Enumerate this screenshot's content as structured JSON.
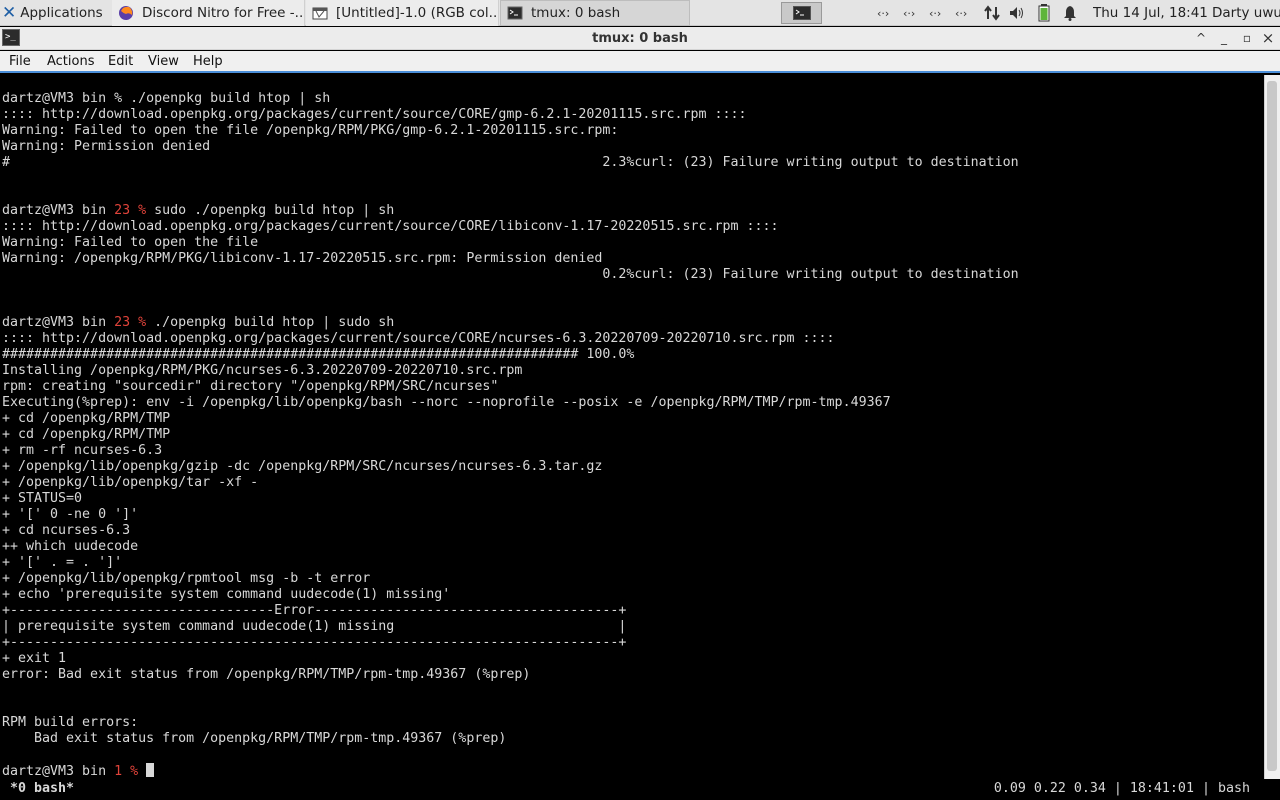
{
  "panel": {
    "applications_label": "Applications",
    "tasks": [
      {
        "label": "Discord Nitro for Free -..."
      },
      {
        "label": "[Untitled]-1.0 (RGB col..."
      },
      {
        "label": "tmux: 0 bash"
      }
    ],
    "clock": "Thu 14 Jul, 18:41",
    "user": "Darty uwu"
  },
  "window": {
    "title": "tmux: 0 bash",
    "controls": {
      "up": "^",
      "minimize": "_",
      "restore": "▫",
      "close": "×"
    }
  },
  "menubar": [
    "File",
    "Actions",
    "Edit",
    "View",
    "Help"
  ],
  "terminal": {
    "lines": [
      {
        "row": 1,
        "segments": [
          {
            "t": "dartz@VM3 bin % ./openpkg build htop | sh"
          }
        ]
      },
      {
        "row": 2,
        "segments": [
          {
            "t": ":::: http://download.openpkg.org/packages/current/source/CORE/gmp-6.2.1-20201115.src.rpm ::::"
          }
        ]
      },
      {
        "row": 3,
        "segments": [
          {
            "t": "Warning: Failed to open the file /openpkg/RPM/PKG/gmp-6.2.1-20201115.src.rpm:"
          }
        ]
      },
      {
        "row": 4,
        "segments": [
          {
            "t": "Warning: Permission denied"
          }
        ]
      },
      {
        "row": 5,
        "segments": [
          {
            "t": "#                                                                          2.3%curl: (23) Failure writing output to destination"
          }
        ]
      },
      {
        "row": 8,
        "segments": [
          {
            "t": "dartz@VM3 bin "
          },
          {
            "t": "23 %",
            "red": true
          },
          {
            "t": " sudo ./openpkg build htop | sh"
          }
        ]
      },
      {
        "row": 9,
        "segments": [
          {
            "t": ":::: http://download.openpkg.org/packages/current/source/CORE/libiconv-1.17-20220515.src.rpm ::::"
          }
        ]
      },
      {
        "row": 10,
        "segments": [
          {
            "t": "Warning: Failed to open the file"
          }
        ]
      },
      {
        "row": 11,
        "segments": [
          {
            "t": "Warning: /openpkg/RPM/PKG/libiconv-1.17-20220515.src.rpm: Permission denied"
          }
        ]
      },
      {
        "row": 12,
        "segments": [
          {
            "t": "                                                                           0.2%curl: (23) Failure writing output to destination"
          }
        ]
      },
      {
        "row": 15,
        "segments": [
          {
            "t": "dartz@VM3 bin "
          },
          {
            "t": "23 %",
            "red": true
          },
          {
            "t": " ./openpkg build htop | sudo sh"
          }
        ]
      },
      {
        "row": 16,
        "segments": [
          {
            "t": ":::: http://download.openpkg.org/packages/current/source/CORE/ncurses-6.3.20220709-20220710.src.rpm ::::"
          }
        ]
      },
      {
        "row": 17,
        "segments": [
          {
            "t": "######################################################################## 100.0%"
          }
        ]
      },
      {
        "row": 18,
        "segments": [
          {
            "t": "Installing /openpkg/RPM/PKG/ncurses-6.3.20220709-20220710.src.rpm"
          }
        ]
      },
      {
        "row": 19,
        "segments": [
          {
            "t": "rpm: creating \"sourcedir\" directory \"/openpkg/RPM/SRC/ncurses\""
          }
        ]
      },
      {
        "row": 20,
        "segments": [
          {
            "t": "Executing(%prep): env -i /openpkg/lib/openpkg/bash --norc --noprofile --posix -e /openpkg/RPM/TMP/rpm-tmp.49367"
          }
        ]
      },
      {
        "row": 21,
        "segments": [
          {
            "t": "+ cd /openpkg/RPM/TMP"
          }
        ]
      },
      {
        "row": 22,
        "segments": [
          {
            "t": "+ cd /openpkg/RPM/TMP"
          }
        ]
      },
      {
        "row": 23,
        "segments": [
          {
            "t": "+ rm -rf ncurses-6.3"
          }
        ]
      },
      {
        "row": 24,
        "segments": [
          {
            "t": "+ /openpkg/lib/openpkg/gzip -dc /openpkg/RPM/SRC/ncurses/ncurses-6.3.tar.gz"
          }
        ]
      },
      {
        "row": 25,
        "segments": [
          {
            "t": "+ /openpkg/lib/openpkg/tar -xf -"
          }
        ]
      },
      {
        "row": 26,
        "segments": [
          {
            "t": "+ STATUS=0"
          }
        ]
      },
      {
        "row": 27,
        "segments": [
          {
            "t": "+ '[' 0 -ne 0 ']'"
          }
        ]
      },
      {
        "row": 28,
        "segments": [
          {
            "t": "+ cd ncurses-6.3"
          }
        ]
      },
      {
        "row": 29,
        "segments": [
          {
            "t": "++ which uudecode"
          }
        ]
      },
      {
        "row": 30,
        "segments": [
          {
            "t": "+ '[' . = . ']'"
          }
        ]
      },
      {
        "row": 31,
        "segments": [
          {
            "t": "+ /openpkg/lib/openpkg/rpmtool msg -b -t error"
          }
        ]
      },
      {
        "row": 32,
        "segments": [
          {
            "t": "+ echo 'prerequisite system command uudecode(1) missing'"
          }
        ]
      },
      {
        "row": 33,
        "segments": [
          {
            "t": "+---------------------------------Error--------------------------------------+"
          }
        ]
      },
      {
        "row": 34,
        "segments": [
          {
            "t": "| prerequisite system command uudecode(1) missing                            |"
          }
        ]
      },
      {
        "row": 35,
        "segments": [
          {
            "t": "+----------------------------------------------------------------------------+"
          }
        ]
      },
      {
        "row": 36,
        "segments": [
          {
            "t": "+ exit 1"
          }
        ]
      },
      {
        "row": 37,
        "segments": [
          {
            "t": "error: Bad exit status from /openpkg/RPM/TMP/rpm-tmp.49367 (%prep)"
          }
        ]
      },
      {
        "row": 40,
        "segments": [
          {
            "t": "RPM build errors:"
          }
        ]
      },
      {
        "row": 41,
        "segments": [
          {
            "t": "    Bad exit status from /openpkg/RPM/TMP/rpm-tmp.49367 (%prep)"
          }
        ]
      },
      {
        "row": 43,
        "segments": [
          {
            "t": "dartz@VM3 bin "
          },
          {
            "t": "1 %",
            "red": true
          },
          {
            "t": " "
          }
        ],
        "cursor": true
      }
    ]
  },
  "tmux": {
    "left": "*0 bash*",
    "right": "0.09 0.22 0.34 | 18:41:01 | bash"
  },
  "colors": {
    "panel_bg": "#e4e4e4",
    "terminal_bg": "#000000",
    "terminal_fg": "#d8d8d8",
    "prompt_status_red": "#e0433a",
    "menubar_accent": "#4a8ed8",
    "xfce_blue": "#1f5fa5"
  },
  "icons": [
    "xfce-logo-icon",
    "firefox-icon",
    "gimp-icon",
    "terminal-icon",
    "network-icon",
    "volume-icon",
    "battery-icon",
    "notification-bell-icon"
  ]
}
